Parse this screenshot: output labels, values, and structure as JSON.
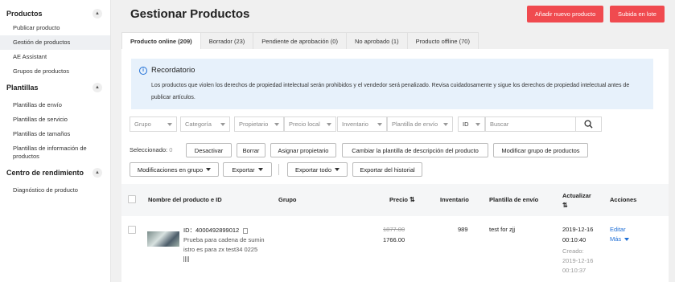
{
  "sidebar": {
    "sections": [
      {
        "title": "Productos",
        "items": [
          "Publicar producto",
          "Gestión de productos",
          "AE Assistant",
          "Grupos de productos"
        ]
      },
      {
        "title": "Plantillas",
        "items": [
          "Plantillas de envío",
          "Plantillas de servicio",
          "Plantillas de tamaños",
          "Plantillas de información de productos"
        ]
      },
      {
        "title": "Centro de rendimiento",
        "items": [
          "Diagnóstico de producto"
        ]
      }
    ],
    "active_item": "Gestión de productos"
  },
  "header": {
    "title": "Gestionar Productos",
    "add_button": "Añadir nuevo producto",
    "bulk_button": "Subida en lote"
  },
  "tabs": [
    {
      "label": "Producto online (209)",
      "active": true
    },
    {
      "label": "Borrador (23)",
      "active": false
    },
    {
      "label": "Pendiente de aprobación (0)",
      "active": false
    },
    {
      "label": "No aprobado (1)",
      "active": false
    },
    {
      "label": "Producto offline (70)",
      "active": false
    }
  ],
  "notice": {
    "title": "Recordatorio",
    "body": "Los productos que violen los derechos de propiedad intelectual serán prohibidos y el vendedor será penalizado. Revisa cuidadosamente y sigue los derechos de propiedad intelectual antes de publicar artículos.",
    "icon": "info-icon"
  },
  "filters": {
    "group": "Grupo",
    "category": "Categoría",
    "owner": "Propietario",
    "local_price": "Precio local",
    "inventory": "Inventario",
    "shipping_template": "Plantilla de envío",
    "search_type": "ID",
    "search_placeholder": "Buscar"
  },
  "actions": {
    "selected_label": "Seleccionado:",
    "selected_count": "0",
    "deactivate": "Desactivar",
    "delete": "Borrar",
    "assign_owner": "Asignar propietario",
    "change_desc_template": "Cambiar la plantilla de descripción del producto",
    "modify_group": "Modificar grupo de productos",
    "bulk_modify": "Modificaciones en grupo",
    "export": "Exportar",
    "export_all": "Exportar todo",
    "export_history": "Exportar del historial"
  },
  "table": {
    "columns": {
      "name": "Nombre del producto e ID",
      "group": "Grupo",
      "price": "Precio",
      "inventory": "Inventario",
      "shipping": "Plantilla de envío",
      "updated": "Actualizar",
      "actions": "Acciones"
    },
    "rows": [
      {
        "id_label": "ID：",
        "id": "4000492899012",
        "name_line1": "Prueba para cadena de sumin",
        "name_line2": "istro es para zx test34 0225",
        "group": "",
        "old_price": "1877.00",
        "price": "1766.00",
        "inventory": "989",
        "shipping": "test for zjj",
        "updated_date": "2019-12-16",
        "updated_time": "00:10:40",
        "created_label": "Creado:",
        "created_date": "2019-12-16",
        "created_time": "00:10:37",
        "edit": "Editar",
        "more": "Más"
      }
    ]
  },
  "colors": {
    "accent": "#f04a4f",
    "link": "#1f6fd6",
    "notice_bg": "#e7f1fb"
  }
}
